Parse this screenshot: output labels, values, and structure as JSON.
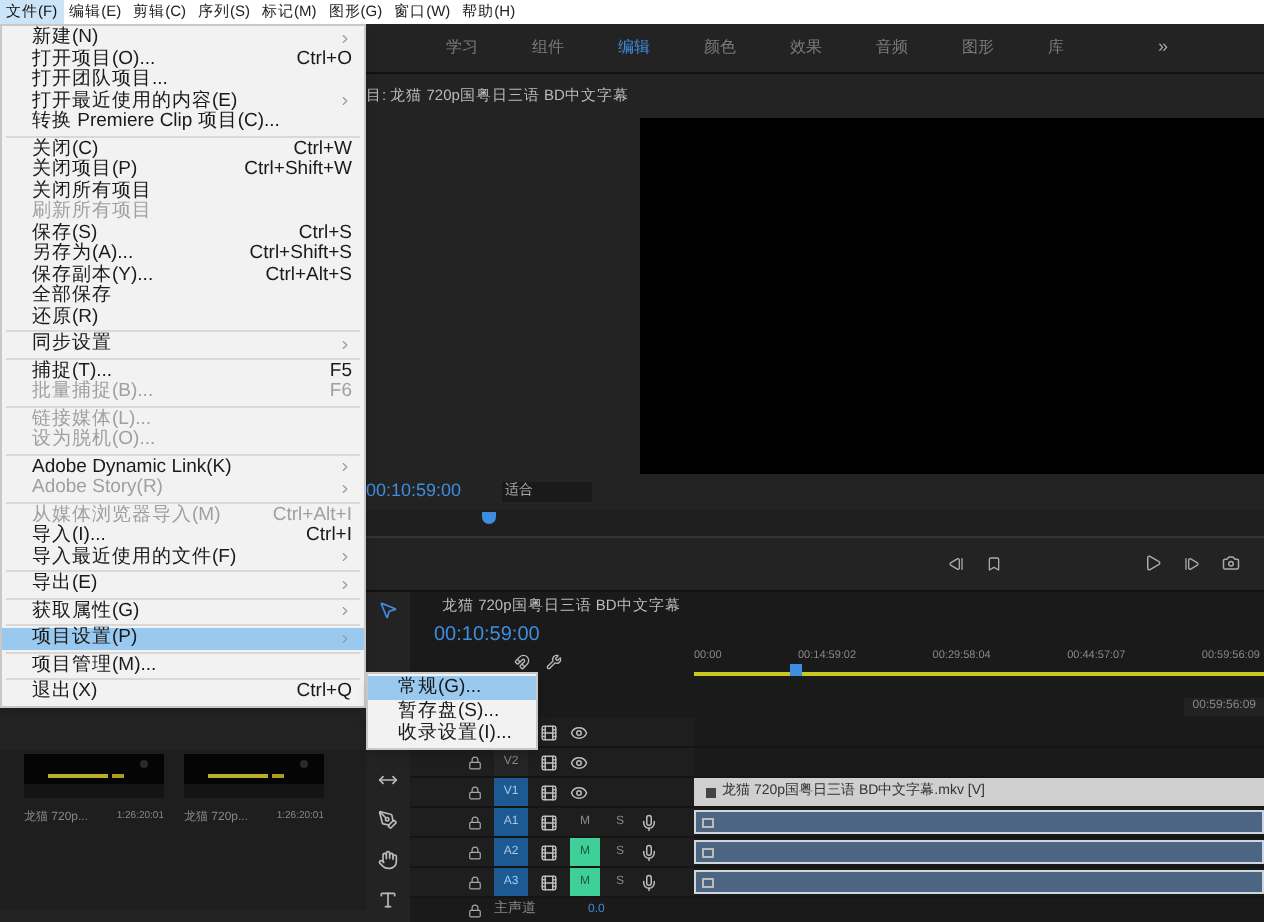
{
  "menubar": [
    {
      "label": "文件(F)",
      "selected": true
    },
    {
      "label": "编辑(E)",
      "selected": false
    },
    {
      "label": "剪辑(C)",
      "selected": false
    },
    {
      "label": "序列(S)",
      "selected": false
    },
    {
      "label": "标记(M)",
      "selected": false
    },
    {
      "label": "图形(G)",
      "selected": false
    },
    {
      "label": "窗口(W)",
      "selected": false
    },
    {
      "label": "帮助(H)",
      "selected": false
    }
  ],
  "file_menu": [
    {
      "kind": "item",
      "label": "新建(N)",
      "submenu": true,
      "disabled": false,
      "selected": false
    },
    {
      "kind": "item",
      "label": "打开项目(O)...",
      "shortcut": "Ctrl+O",
      "submenu": false,
      "disabled": false,
      "selected": false
    },
    {
      "kind": "item",
      "label": "打开团队项目...",
      "submenu": false,
      "disabled": false,
      "selected": false
    },
    {
      "kind": "item",
      "label": "打开最近使用的内容(E)",
      "submenu": true,
      "disabled": false,
      "selected": false
    },
    {
      "kind": "item",
      "label": "转换 Premiere Clip 项目(C)...",
      "submenu": false,
      "disabled": false,
      "selected": false
    },
    {
      "kind": "separator"
    },
    {
      "kind": "item",
      "label": "关闭(C)",
      "shortcut": "Ctrl+W",
      "submenu": false,
      "disabled": false,
      "selected": false
    },
    {
      "kind": "item",
      "label": "关闭项目(P)",
      "shortcut": "Ctrl+Shift+W",
      "submenu": false,
      "disabled": false,
      "selected": false
    },
    {
      "kind": "item",
      "label": "关闭所有项目",
      "submenu": false,
      "disabled": false,
      "selected": false
    },
    {
      "kind": "item",
      "label": "刷新所有项目",
      "submenu": false,
      "disabled": true,
      "selected": false
    },
    {
      "kind": "item",
      "label": "保存(S)",
      "shortcut": "Ctrl+S",
      "submenu": false,
      "disabled": false,
      "selected": false
    },
    {
      "kind": "item",
      "label": "另存为(A)...",
      "shortcut": "Ctrl+Shift+S",
      "submenu": false,
      "disabled": false,
      "selected": false
    },
    {
      "kind": "item",
      "label": "保存副本(Y)...",
      "shortcut": "Ctrl+Alt+S",
      "submenu": false,
      "disabled": false,
      "selected": false
    },
    {
      "kind": "item",
      "label": "全部保存",
      "submenu": false,
      "disabled": false,
      "selected": false
    },
    {
      "kind": "item",
      "label": "还原(R)",
      "submenu": false,
      "disabled": false,
      "selected": false
    },
    {
      "kind": "separator"
    },
    {
      "kind": "item",
      "label": "同步设置",
      "submenu": true,
      "disabled": false,
      "selected": false
    },
    {
      "kind": "separator"
    },
    {
      "kind": "item",
      "label": "捕捉(T)...",
      "shortcut": "F5",
      "submenu": false,
      "disabled": false,
      "selected": false
    },
    {
      "kind": "item",
      "label": "批量捕捉(B)...",
      "shortcut": "F6",
      "submenu": false,
      "disabled": true,
      "selected": false
    },
    {
      "kind": "separator"
    },
    {
      "kind": "item",
      "label": "链接媒体(L)...",
      "submenu": false,
      "disabled": true,
      "selected": false
    },
    {
      "kind": "item",
      "label": "设为脱机(O)...",
      "submenu": false,
      "disabled": true,
      "selected": false
    },
    {
      "kind": "separator"
    },
    {
      "kind": "item",
      "label": "Adobe Dynamic Link(K)",
      "submenu": true,
      "disabled": false,
      "selected": false
    },
    {
      "kind": "item",
      "label": "Adobe Story(R)",
      "submenu": true,
      "disabled": true,
      "selected": false
    },
    {
      "kind": "separator"
    },
    {
      "kind": "item",
      "label": "从媒体浏览器导入(M)",
      "shortcut": "Ctrl+Alt+I",
      "submenu": false,
      "disabled": true,
      "selected": false
    },
    {
      "kind": "item",
      "label": "导入(I)...",
      "shortcut": "Ctrl+I",
      "submenu": false,
      "disabled": false,
      "selected": false
    },
    {
      "kind": "item",
      "label": "导入最近使用的文件(F)",
      "submenu": true,
      "disabled": false,
      "selected": false
    },
    {
      "kind": "separator"
    },
    {
      "kind": "item",
      "label": "导出(E)",
      "submenu": true,
      "disabled": false,
      "selected": false
    },
    {
      "kind": "separator"
    },
    {
      "kind": "item",
      "label": "获取属性(G)",
      "submenu": true,
      "disabled": false,
      "selected": false
    },
    {
      "kind": "separator"
    },
    {
      "kind": "item",
      "label": "项目设置(P)",
      "submenu": true,
      "disabled": false,
      "selected": true
    },
    {
      "kind": "separator"
    },
    {
      "kind": "item",
      "label": "项目管理(M)...",
      "submenu": false,
      "disabled": false,
      "selected": false
    },
    {
      "kind": "separator"
    },
    {
      "kind": "item",
      "label": "退出(X)",
      "shortcut": "Ctrl+Q",
      "submenu": false,
      "disabled": false,
      "selected": false
    }
  ],
  "submenu": [
    {
      "label": "常规(G)...",
      "selected": true
    },
    {
      "label": "暂存盘(S)...",
      "selected": false
    },
    {
      "label": "收录设置(I)...",
      "selected": false
    }
  ],
  "workspaces": [
    {
      "label": "学习",
      "selected": false
    },
    {
      "label": "组件",
      "selected": false
    },
    {
      "label": "编辑",
      "selected": true
    },
    {
      "label": "颜色",
      "selected": false
    },
    {
      "label": "效果",
      "selected": false
    },
    {
      "label": "音频",
      "selected": false
    },
    {
      "label": "图形",
      "selected": false
    },
    {
      "label": "库",
      "selected": false
    }
  ],
  "workspace_more": "»",
  "program_monitor": {
    "title": "目: 龙猫 720p国粤日三语 BD中文字幕",
    "timecode": "00:10:59:00",
    "zoom": "适合",
    "level": 0.13
  },
  "timeline": {
    "title": "龙猫 720p国粤日三语 BD中文字幕",
    "timecode": "00:10:59:00",
    "ruler": [
      "00:00",
      "00:14:59:02",
      "00:29:58:04",
      "00:44:57:07",
      "00:59:56:09"
    ],
    "end_time": "00:59:56:09",
    "level": 0.17,
    "tracks": [
      {
        "kind": "video"
      },
      {
        "kind": "video",
        "label": "V2",
        "targeted": false
      },
      {
        "kind": "video",
        "label": "V1",
        "targeted": true,
        "clip": "龙猫 720p国粤日三语 BD中文字幕.mkv [V]"
      },
      {
        "kind": "audio",
        "label": "A1",
        "targeted": true,
        "mute": "M",
        "muted": false,
        "solo": "S"
      },
      {
        "kind": "audio",
        "label": "A2",
        "targeted": true,
        "mute": "M",
        "muted": true,
        "solo": "S"
      },
      {
        "kind": "audio",
        "label": "A3",
        "targeted": true,
        "mute": "M",
        "muted": true,
        "solo": "S"
      }
    ],
    "master": {
      "label": "主声道",
      "value": "0.0"
    }
  },
  "project_items": [
    {
      "name": "龙猫 720p...",
      "duration": "1:26:20:01"
    },
    {
      "name": "龙猫 720p...",
      "duration": "1:26:20:01"
    }
  ]
}
